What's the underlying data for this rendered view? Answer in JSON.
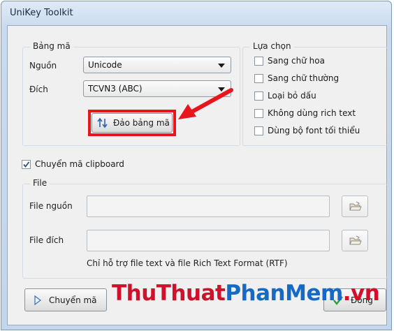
{
  "window": {
    "title": "UniKey Toolkit"
  },
  "bang_ma": {
    "legend": "Bảng mã",
    "source_label": "Nguồn",
    "source_value": "Unicode",
    "dest_label": "Đích",
    "dest_value": "TCVN3 (ABC)",
    "swap_label": "Đảo bảng mã"
  },
  "lua_chon": {
    "legend": "Lựa chọn",
    "options": [
      {
        "label": "Sang chữ hoa",
        "checked": false
      },
      {
        "label": "Sang chữ thường",
        "checked": false
      },
      {
        "label": "Loại bỏ dấu",
        "checked": false
      },
      {
        "label": "Không dùng rich text",
        "checked": false
      },
      {
        "label": "Dùng bộ font tối thiểu",
        "checked": false
      }
    ]
  },
  "clipboard": {
    "label": "Chuyển mã clipboard",
    "checked": true
  },
  "file": {
    "legend": "File",
    "source_label": "File nguồn",
    "source_value": "",
    "dest_label": "File đích",
    "dest_value": "",
    "note": "Chỉ hỗ trợ file text và file Rich Text Format (RTF)"
  },
  "footer": {
    "convert_label": "Chuyển mã",
    "close_label": "Đóng"
  },
  "watermark": {
    "part1": "ThuThuat",
    "part2": "PhanMem",
    "part3": ".vn"
  },
  "colors": {
    "highlight": "#e8161c",
    "watermark_red": "#d0112b",
    "watermark_blue": "#1669c4"
  },
  "icons": [
    "swap-arrows-icon",
    "folder-open-icon",
    "play-triangle-icon",
    "check-mark-icon"
  ]
}
